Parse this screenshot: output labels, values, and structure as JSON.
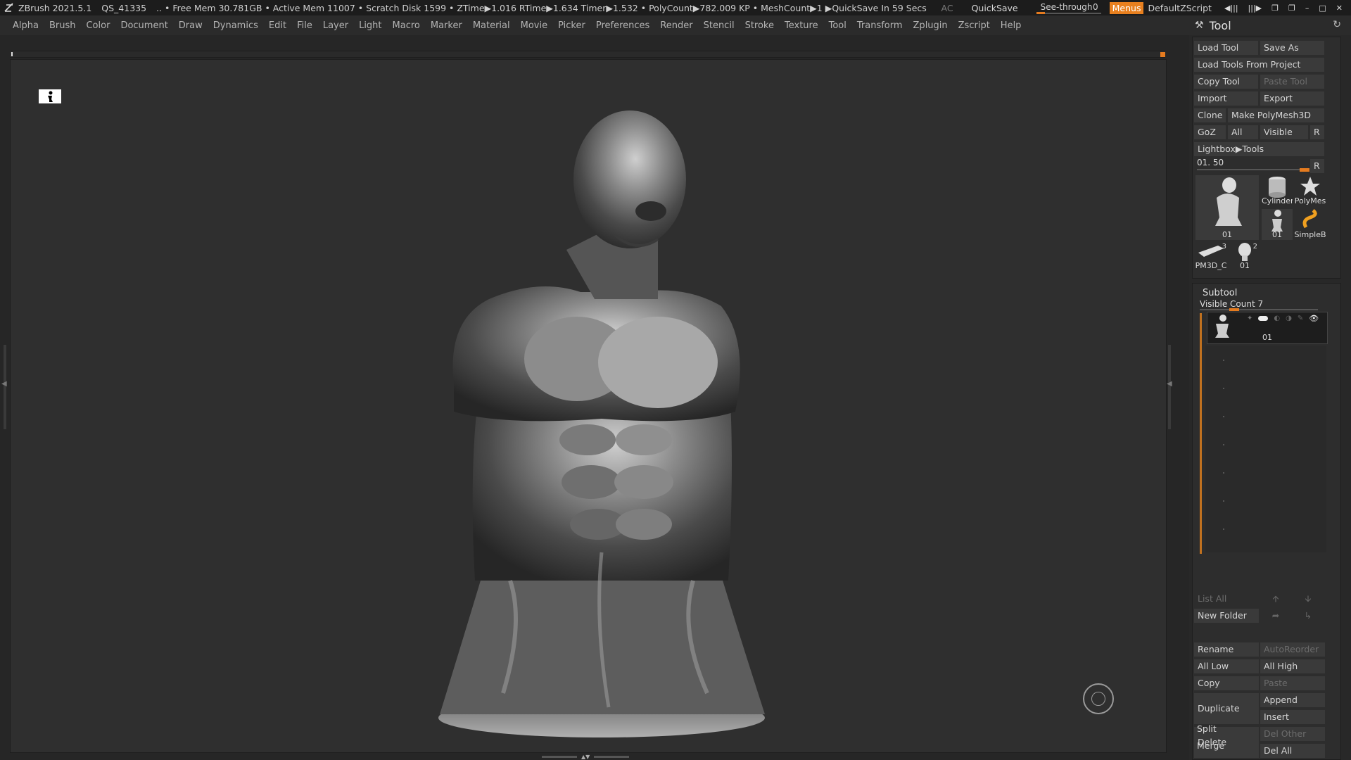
{
  "titlebar": {
    "app_title": "ZBrush 2021.5.1",
    "doc_id": "QS_41335",
    "stats": ".. • Free Mem 30.781GB • Active Mem 11007 • Scratch Disk 1599 • ZTime▶1.016 RTime▶1.634 Timer▶1.532 • PolyCount▶782.009 KP • MeshCount▶1 ▶QuickSave In 59 Secs",
    "ac_label": "AC",
    "quicksave_label": "QuickSave",
    "seethrough_label": "See-through",
    "seethrough_value": "0",
    "seethrough_level": 0,
    "menus_label": "Menus",
    "default_zscript_label": "DefaultZScript",
    "accent_color": "#e8801f"
  },
  "menubar": {
    "items": [
      "Alpha",
      "Brush",
      "Color",
      "Document",
      "Draw",
      "Dynamics",
      "Edit",
      "File",
      "Layer",
      "Light",
      "Macro",
      "Marker",
      "Material",
      "Movie",
      "Picker",
      "Preferences",
      "Render",
      "Stencil",
      "Stroke",
      "Texture",
      "Tool",
      "Transform",
      "Zplugin",
      "Zscript",
      "Help"
    ]
  },
  "tool_panel": {
    "title": "Tool",
    "load_tool": "Load Tool",
    "save_as": "Save As",
    "load_tools_from_project": "Load Tools From Project",
    "copy_tool": "Copy Tool",
    "paste_tool": "Paste Tool",
    "import": "Import",
    "export": "Export",
    "clone": "Clone",
    "make_polymesh3d": "Make PolyMesh3D",
    "goz": "GoZ",
    "all": "All",
    "visible": "Visible",
    "r": "R",
    "lightbox_tools": "Lightbox▶Tools",
    "tool_slider_label": "01. 50",
    "tool_slider_r": "R",
    "thumbs": {
      "main": "01",
      "cylinder": "Cylinder",
      "polymesh": "PolyMes",
      "small01": "01",
      "simpleb": "SimpleB",
      "pm3d": "PM3D_C",
      "pm3d_num": "3",
      "head01": "01",
      "head01_num": "2"
    }
  },
  "subtool": {
    "title": "Subtool",
    "visible_count": "Visible Count 7",
    "item_name": "01",
    "list_all": "List All",
    "new_folder": "New Folder",
    "rename": "Rename",
    "autoreorder": "AutoReorder",
    "all_low": "All Low",
    "all_high": "All High",
    "copy": "Copy",
    "paste": "Paste",
    "duplicate": "Duplicate",
    "append": "Append",
    "insert": "Insert",
    "del_other": "Del Other",
    "delete": "Delete",
    "del_all": "Del All",
    "split": "Split",
    "merge": "Merge"
  }
}
